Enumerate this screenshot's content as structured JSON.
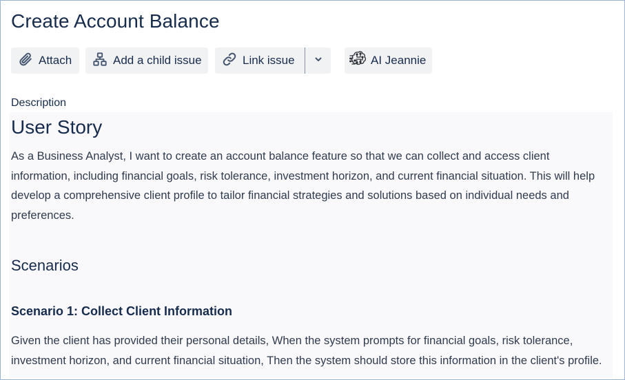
{
  "issue": {
    "title": "Create Account Balance"
  },
  "toolbar": {
    "attach_label": "Attach",
    "add_child_label": "Add a child issue",
    "link_issue_label": "Link issue",
    "ai_label": "AI Jeannie"
  },
  "icons": {
    "attach": "paperclip-icon",
    "child": "hierarchy-icon",
    "link": "link-icon",
    "dropdown": "chevron-down-icon",
    "ai": "brain-circuit-icon"
  },
  "description": {
    "label": "Description",
    "heading": "User Story",
    "story": "As a Business Analyst, I want to create an account balance feature so that we can collect and access client information, including financial goals, risk tolerance, investment horizon, and current financial situation. This will help develop a comprehensive client profile to tailor financial strategies and solutions based on individual needs and preferences.",
    "scenarios_heading": "Scenarios",
    "scenario1_title": "Scenario 1: Collect Client Information",
    "scenario1_text": "Given the client has provided their personal details,   When the system prompts for financial goals, risk tolerance, investment horizon, and current financial situation,   Then the system should store this information in the client's profile."
  },
  "colors": {
    "text": "#172b4d",
    "button_bg": "#f1f2f4",
    "description_bg": "#f9f9fb",
    "frame_border": "#9db3d6"
  }
}
